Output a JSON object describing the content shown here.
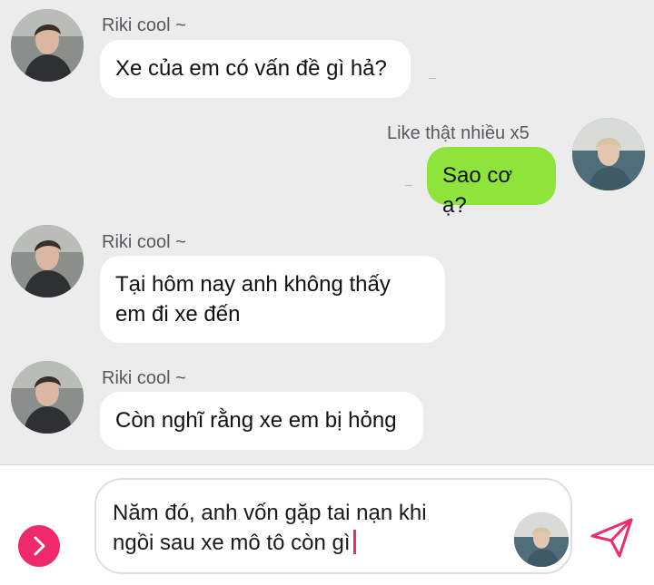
{
  "messages": [
    {
      "sender": "Riki cool ~",
      "lines": [
        "Xe của em có vấn đề gì hả?"
      ],
      "direction": "incoming"
    },
    {
      "sender": "Like thật nhiều x5",
      "lines": [
        "Sao cơ ạ?"
      ],
      "direction": "outgoing"
    },
    {
      "sender": "Riki cool ~",
      "lines": [
        "Tại hôm nay anh không thấy",
        "em đi xe đến"
      ],
      "direction": "incoming"
    },
    {
      "sender": "Riki cool ~",
      "lines": [
        "Còn nghĩ rằng xe em bị hỏng"
      ],
      "direction": "incoming"
    }
  ],
  "composer": {
    "draft_lines": [
      "Năm đó, anh vốn gặp tai nạn khi",
      "ngồi sau xe mô tô còn gì"
    ],
    "toggle_icon": "chevron-right-icon",
    "send_icon": "paper-plane-icon"
  },
  "colors": {
    "background": "#ececec",
    "incoming_bubble": "#ffffff",
    "outgoing_bubble": "#8ee43a",
    "accent": "#f0296b"
  }
}
